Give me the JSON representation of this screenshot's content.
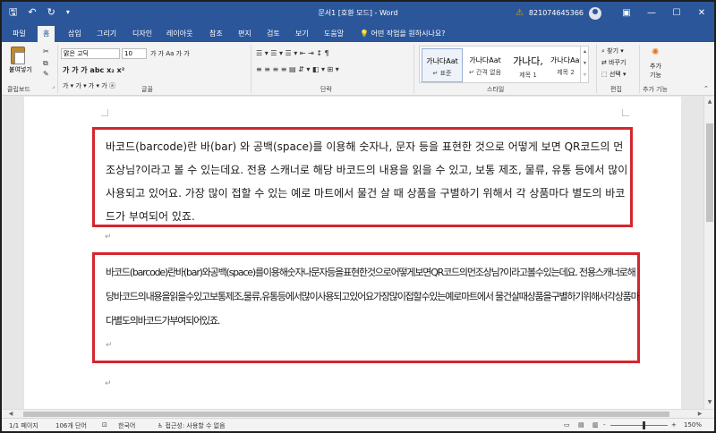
{
  "titlebar": {
    "title": "문서1 [호환 모드]  -  Word",
    "user": "821074645366",
    "save_icon": "save-icon",
    "undo_icon": "undo-icon",
    "redo_icon": "redo-icon",
    "minimize_icon": "minimize-icon",
    "restore_icon": "restore-icon",
    "close_icon": "close-icon",
    "ribbon_display_icon": "ribbon-display-icon"
  },
  "tabs": [
    "파일",
    "홈",
    "삽입",
    "그리기",
    "디자인",
    "레이아웃",
    "참조",
    "편지",
    "검토",
    "보기",
    "도움말"
  ],
  "active_tab": "홈",
  "tell_me": "어떤 작업을 원하시나요?",
  "ribbon": {
    "clipboard": {
      "paste": "붙여넣기",
      "group": "클립보드"
    },
    "font": {
      "name": "맑은 고딕",
      "size": "10",
      "group": "글꼴",
      "row1_extra": "가  가  Aa  가  가",
      "row2": "가  가  가  abc  x₂  x²",
      "row3": "가  ▾  가  ▾  가  ▾  가  ⓐ"
    },
    "paragraph": {
      "group": "단락"
    },
    "styles": {
      "group": "스타일",
      "items": [
        {
          "sample": "가나다Aat",
          "name": "↵ 표준"
        },
        {
          "sample": "가나다Aat",
          "name": "↵ 간격 없음"
        },
        {
          "sample": "가나다,",
          "name": "제목 1"
        },
        {
          "sample": "가나다Aat",
          "name": "제목 2"
        }
      ]
    },
    "editing": {
      "find": "찾기",
      "replace": "바꾸기",
      "select": "선택",
      "group": "편집"
    },
    "addins": {
      "label_1": "추가",
      "label_2": "기능",
      "group": "추가 기능"
    }
  },
  "document": {
    "para1": "바코드(barcode)란 바(bar) 와 공백(space)를 이용해 숫자나, 문자 등을 표현한 것으로 어떻게 보면 QR코드의 먼 조상님?이라고 볼 수 있는데요. 전용 스캐너로 해당 바코드의 내용을 읽을 수 있고, 보통 제조, 물류, 유통 등에서 많이 사용되고 있어요. 가장 많이 접할 수 있는 예로 마트에서 물건 살 때 상품을 구별하기 위해서 각 상품마다 별도의 바코드가 부여되어 있죠.",
    "para2": "바코드(barcode)란바(bar)와공백(space)를이용해숫자나문자등을표현한것으로어떻게보면QR코드의먼조상님?이라고볼수있는데요. 전용스캐너로해당바코드의내용을읽을수있고보통제조,물류,유통등에서많이사용되고있어요가장많이접할수있는예로마트에서 물건살때상품을구별하기위해서각상품마다별도의바코드가부여되어있죠.",
    "para_mark": "↵",
    "para_end_mark": "↵"
  },
  "statusbar": {
    "pages": "1/1 페이지",
    "words": "106개 단어",
    "lang": "한국어",
    "accessibility": "접근성: 사용할 수 없음",
    "zoom": "150%",
    "zoom_minus": "-",
    "zoom_plus": "+"
  },
  "colors": {
    "word_blue": "#2b579a",
    "highlight_box": "#d4262e"
  }
}
